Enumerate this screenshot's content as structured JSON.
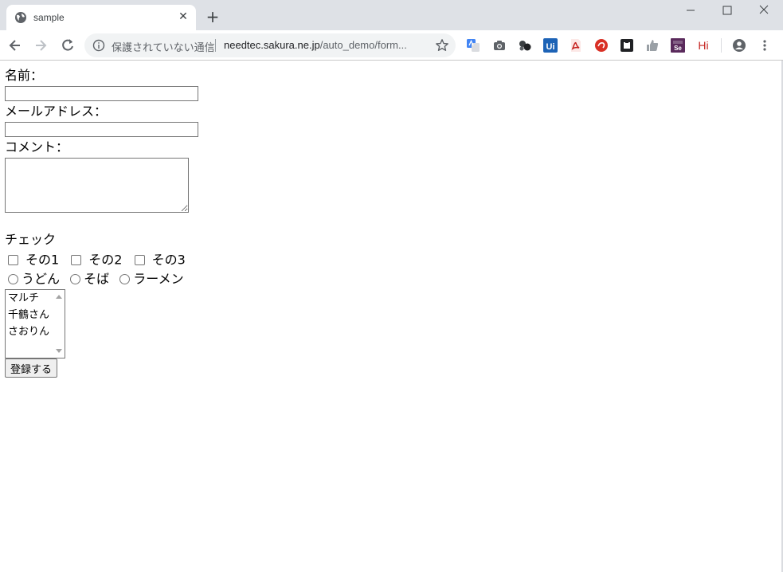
{
  "browser": {
    "tab_title": "sample",
    "security_label": "保護されていない通信",
    "url_host": "needtec.sakura.ne.jp",
    "url_path": "/auto_demo/form...",
    "extension_colors": {
      "ui": "#1d63b6",
      "pdf": "#c5221f",
      "hi": "#c5221f",
      "selenium": "#5a2a5c"
    }
  },
  "form": {
    "name_label": "名前：",
    "name_value": "",
    "email_label": "メールアドレス：",
    "email_value": "",
    "comment_label": "コメント：",
    "comment_value": "",
    "check_label": "チェック",
    "checkboxes": [
      {
        "label": "その1",
        "checked": false
      },
      {
        "label": "その2",
        "checked": false
      },
      {
        "label": "その3",
        "checked": false
      }
    ],
    "radios": [
      {
        "label": "うどん",
        "selected": false
      },
      {
        "label": "そば",
        "selected": false
      },
      {
        "label": "ラーメン",
        "selected": false
      }
    ],
    "multiselect_options": [
      "マルチ",
      "千鶴さん",
      "さおりん"
    ],
    "submit_label": "登録する"
  }
}
